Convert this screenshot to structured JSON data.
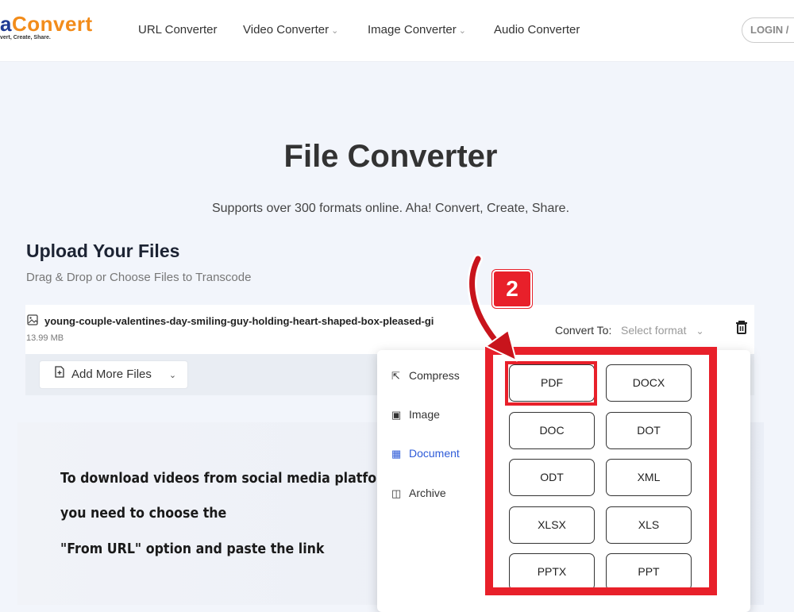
{
  "header": {
    "logo_prefix": "a",
    "logo_main": "Convert",
    "tagline": "vert, Create, Share.",
    "nav": [
      {
        "label": "URL Converter",
        "dropdown": false
      },
      {
        "label": "Video Converter",
        "dropdown": true
      },
      {
        "label": "Image Converter",
        "dropdown": true
      },
      {
        "label": "Audio Converter",
        "dropdown": false
      }
    ],
    "login_label": "LOGIN /"
  },
  "hero": {
    "title": "File Converter",
    "subtitle": "Supports over 300 formats online. Aha! Convert, Create, Share."
  },
  "upload": {
    "title": "Upload Your Files",
    "subtitle": "Drag & Drop or Choose Files to Transcode"
  },
  "file": {
    "name": "young-couple-valentines-day-smiling-guy-holding-heart-shaped-box-pleased-gi",
    "size": "13.99 MB",
    "convert_to_label": "Convert To:",
    "select_placeholder": "Select format"
  },
  "actions": {
    "add_more_label": "Add More Files"
  },
  "dropdown": {
    "categories": [
      {
        "label": "Compress",
        "icon": "compress-icon",
        "active": false
      },
      {
        "label": "Image",
        "icon": "image-icon",
        "active": false
      },
      {
        "label": "Document",
        "icon": "document-icon",
        "active": true
      },
      {
        "label": "Archive",
        "icon": "archive-icon",
        "active": false
      }
    ],
    "formats": [
      "PDF",
      "DOCX",
      "DOC",
      "DOT",
      "ODT",
      "XML",
      "XLSX",
      "XLS",
      "PPTX",
      "PPT"
    ]
  },
  "promo": {
    "lines": [
      "To download videos from social media platfo",
      "you need to choose the",
      "\"From URL\" option and paste the link"
    ]
  },
  "annotation": {
    "step_badge": "2",
    "highlight_color": "#e8202a"
  },
  "colors": {
    "brand_orange": "#f28c1b",
    "brand_blue": "#1f3a93",
    "active_blue": "#2e5bd8",
    "convert_button": "#7f98d8"
  }
}
